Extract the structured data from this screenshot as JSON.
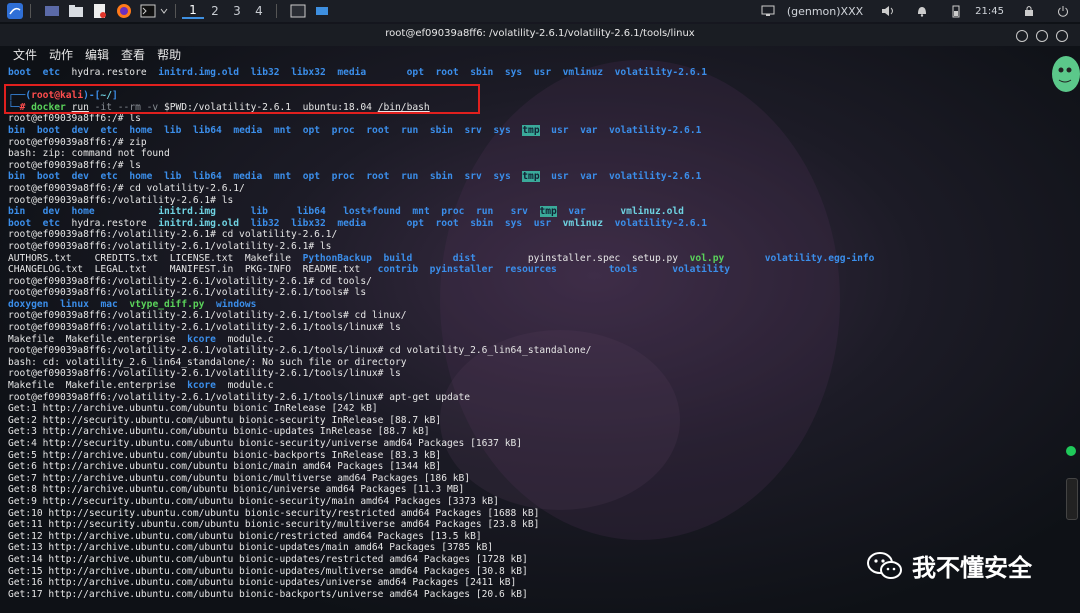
{
  "taskbar": {
    "workspaces": [
      "1",
      "2",
      "3",
      "4"
    ],
    "user": "(genmon)XXX",
    "time": "21:45",
    "icons": [
      "kali-menu-icon",
      "desktop-icon",
      "folder-icon",
      "text-editor-icon",
      "firefox-icon",
      "terminal-icon",
      "chevron-down-icon",
      "terminal-window-icon",
      "window-icon"
    ]
  },
  "window": {
    "title": "root@ef09039a8ff6: /volatility-2.6.1/volatility-2.6.1/tools/linux",
    "menu": [
      "文件",
      "动作",
      "编辑",
      "查看",
      "帮助"
    ]
  },
  "terminal": {
    "lines": [
      [
        [
          "boot",
          "blue"
        ],
        [
          "  "
        ],
        [
          "etc",
          "blue"
        ],
        [
          "  hydra.restore  "
        ],
        [
          "initrd.img.old",
          "blue"
        ],
        [
          "  "
        ],
        [
          "lib32",
          "blue"
        ],
        [
          "  "
        ],
        [
          "libx32",
          "blue"
        ],
        [
          "  "
        ],
        [
          "media",
          "blue"
        ],
        [
          "       "
        ],
        [
          "opt",
          "blue"
        ],
        [
          "  "
        ],
        [
          "root",
          "blue"
        ],
        [
          "  "
        ],
        [
          "sbin",
          "blue"
        ],
        [
          "  "
        ],
        [
          "sys",
          "blue"
        ],
        [
          "  "
        ],
        [
          "usr",
          "blue"
        ],
        [
          "  "
        ],
        [
          "vmlinuz",
          "blue"
        ],
        [
          "  "
        ],
        [
          "volatility-2.6.1",
          "blue"
        ]
      ],
      [
        [
          ""
        ]
      ],
      [
        [
          "┌──(",
          "blue"
        ],
        [
          "root@kali",
          "red"
        ],
        [
          ")-[",
          "blue"
        ],
        [
          "~/",
          "cyan"
        ],
        [
          "]",
          "blue"
        ]
      ],
      [
        [
          "└─",
          "blue"
        ],
        [
          "# ",
          "red"
        ],
        [
          "docker ",
          "green"
        ],
        [
          "run",
          "ul"
        ],
        [
          " -it --rm -v ",
          "dim"
        ],
        [
          "$PWD:/volatility-2.6.1  ubuntu:18.04 "
        ],
        [
          "/bin/bash",
          "ul"
        ]
      ],
      [
        [
          "root@ef09039a8ff6:/# ls"
        ]
      ],
      [
        [
          "bin",
          "blue"
        ],
        [
          "  "
        ],
        [
          "boot",
          "blue"
        ],
        [
          "  "
        ],
        [
          "dev",
          "blue"
        ],
        [
          "  "
        ],
        [
          "etc",
          "blue"
        ],
        [
          "  "
        ],
        [
          "home",
          "blue"
        ],
        [
          "  "
        ],
        [
          "lib",
          "blue"
        ],
        [
          "  "
        ],
        [
          "lib64",
          "blue"
        ],
        [
          "  "
        ],
        [
          "media",
          "blue"
        ],
        [
          "  "
        ],
        [
          "mnt",
          "blue"
        ],
        [
          "  "
        ],
        [
          "opt",
          "blue"
        ],
        [
          "  "
        ],
        [
          "proc",
          "blue"
        ],
        [
          "  "
        ],
        [
          "root",
          "blue"
        ],
        [
          "  "
        ],
        [
          "run",
          "blue"
        ],
        [
          "  "
        ],
        [
          "sbin",
          "blue"
        ],
        [
          "  "
        ],
        [
          "srv",
          "blue"
        ],
        [
          "  "
        ],
        [
          "sys",
          "blue"
        ],
        [
          "  "
        ],
        [
          "tmp",
          "hl"
        ],
        [
          "  "
        ],
        [
          "usr",
          "blue"
        ],
        [
          "  "
        ],
        [
          "var",
          "blue"
        ],
        [
          "  "
        ],
        [
          "volatility-2.6.1",
          "blue"
        ]
      ],
      [
        [
          "root@ef09039a8ff6:/# zip"
        ]
      ],
      [
        [
          "bash: zip: command not found"
        ]
      ],
      [
        [
          "root@ef09039a8ff6:/# ls"
        ]
      ],
      [
        [
          "bin",
          "blue"
        ],
        [
          "  "
        ],
        [
          "boot",
          "blue"
        ],
        [
          "  "
        ],
        [
          "dev",
          "blue"
        ],
        [
          "  "
        ],
        [
          "etc",
          "blue"
        ],
        [
          "  "
        ],
        [
          "home",
          "blue"
        ],
        [
          "  "
        ],
        [
          "lib",
          "blue"
        ],
        [
          "  "
        ],
        [
          "lib64",
          "blue"
        ],
        [
          "  "
        ],
        [
          "media",
          "blue"
        ],
        [
          "  "
        ],
        [
          "mnt",
          "blue"
        ],
        [
          "  "
        ],
        [
          "opt",
          "blue"
        ],
        [
          "  "
        ],
        [
          "proc",
          "blue"
        ],
        [
          "  "
        ],
        [
          "root",
          "blue"
        ],
        [
          "  "
        ],
        [
          "run",
          "blue"
        ],
        [
          "  "
        ],
        [
          "sbin",
          "blue"
        ],
        [
          "  "
        ],
        [
          "srv",
          "blue"
        ],
        [
          "  "
        ],
        [
          "sys",
          "blue"
        ],
        [
          "  "
        ],
        [
          "tmp",
          "hl"
        ],
        [
          "  "
        ],
        [
          "usr",
          "blue"
        ],
        [
          "  "
        ],
        [
          "var",
          "blue"
        ],
        [
          "  "
        ],
        [
          "volatility-2.6.1",
          "blue"
        ]
      ],
      [
        [
          "root@ef09039a8ff6:/# cd volatility-2.6.1/"
        ]
      ],
      [
        [
          "root@ef09039a8ff6:/volatility-2.6.1# ls"
        ]
      ],
      [
        [
          "bin",
          "blue"
        ],
        [
          "   "
        ],
        [
          "dev",
          "blue"
        ],
        [
          "  "
        ],
        [
          "home",
          "blue"
        ],
        [
          "           "
        ],
        [
          "initrd.img",
          "cyan"
        ],
        [
          "      "
        ],
        [
          "lib",
          "blue"
        ],
        [
          "     "
        ],
        [
          "lib64",
          "blue"
        ],
        [
          "   "
        ],
        [
          "lost+found",
          "blue"
        ],
        [
          "  "
        ],
        [
          "mnt",
          "blue"
        ],
        [
          "  "
        ],
        [
          "proc",
          "blue"
        ],
        [
          "  "
        ],
        [
          "run",
          "blue"
        ],
        [
          "   "
        ],
        [
          "srv",
          "blue"
        ],
        [
          "  "
        ],
        [
          "tmp",
          "hl"
        ],
        [
          "  "
        ],
        [
          "var",
          "blue"
        ],
        [
          "      "
        ],
        [
          "vmlinuz.old",
          "cyan"
        ]
      ],
      [
        [
          "boot",
          "blue"
        ],
        [
          "  "
        ],
        [
          "etc",
          "blue"
        ],
        [
          "  hydra.restore  "
        ],
        [
          "initrd.img.old",
          "cyan"
        ],
        [
          "  "
        ],
        [
          "lib32",
          "blue"
        ],
        [
          "  "
        ],
        [
          "libx32",
          "blue"
        ],
        [
          "  "
        ],
        [
          "media",
          "blue"
        ],
        [
          "       "
        ],
        [
          "opt",
          "blue"
        ],
        [
          "  "
        ],
        [
          "root",
          "blue"
        ],
        [
          "  "
        ],
        [
          "sbin",
          "blue"
        ],
        [
          "  "
        ],
        [
          "sys",
          "blue"
        ],
        [
          "  "
        ],
        [
          "usr",
          "blue"
        ],
        [
          "  "
        ],
        [
          "vmlinuz",
          "cyan"
        ],
        [
          "  "
        ],
        [
          "volatility-2.6.1",
          "blue"
        ]
      ],
      [
        [
          "root@ef09039a8ff6:/volatility-2.6.1# cd volatility-2.6.1/"
        ]
      ],
      [
        [
          "root@ef09039a8ff6:/volatility-2.6.1/volatility-2.6.1# ls"
        ]
      ],
      [
        [
          "AUTHORS.txt    CREDITS.txt  LICENSE.txt  Makefile  "
        ],
        [
          "PythonBackup",
          "blue"
        ],
        [
          "  "
        ],
        [
          "build",
          "blue"
        ],
        [
          "       "
        ],
        [
          "dist",
          "blue"
        ],
        [
          "         pyinstaller.spec  setup.py  "
        ],
        [
          "vol.py",
          "green"
        ],
        [
          "       "
        ],
        [
          "volatility.egg-info",
          "blue"
        ]
      ],
      [
        [
          "CHANGELOG.txt  LEGAL.txt    MANIFEST.in  PKG-INFO  README.txt   "
        ],
        [
          "contrib",
          "blue"
        ],
        [
          "  "
        ],
        [
          "pyinstaller",
          "blue"
        ],
        [
          "  "
        ],
        [
          "resources",
          "blue"
        ],
        [
          "         "
        ],
        [
          "tools",
          "blue"
        ],
        [
          "      "
        ],
        [
          "volatility",
          "blue"
        ]
      ],
      [
        [
          "root@ef09039a8ff6:/volatility-2.6.1/volatility-2.6.1# cd tools/"
        ]
      ],
      [
        [
          "root@ef09039a8ff6:/volatility-2.6.1/volatility-2.6.1/tools# ls"
        ]
      ],
      [
        [
          "doxygen",
          "blue"
        ],
        [
          "  "
        ],
        [
          "linux",
          "blue"
        ],
        [
          "  "
        ],
        [
          "mac",
          "blue"
        ],
        [
          "  "
        ],
        [
          "vtype_diff.py",
          "green"
        ],
        [
          "  "
        ],
        [
          "windows",
          "blue"
        ]
      ],
      [
        [
          "root@ef09039a8ff6:/volatility-2.6.1/volatility-2.6.1/tools# cd linux/"
        ]
      ],
      [
        [
          "root@ef09039a8ff6:/volatility-2.6.1/volatility-2.6.1/tools/linux# ls"
        ]
      ],
      [
        [
          "Makefile  Makefile.enterprise  "
        ],
        [
          "kcore",
          "blue"
        ],
        [
          "  module.c"
        ]
      ],
      [
        [
          "root@ef09039a8ff6:/volatility-2.6.1/volatility-2.6.1/tools/linux# cd volatility_2.6_lin64_standalone/"
        ]
      ],
      [
        [
          "bash: cd: volatility_2.6_lin64_standalone/: No such file or directory"
        ]
      ],
      [
        [
          "root@ef09039a8ff6:/volatility-2.6.1/volatility-2.6.1/tools/linux# ls"
        ]
      ],
      [
        [
          "Makefile  Makefile.enterprise  "
        ],
        [
          "kcore",
          "blue"
        ],
        [
          "  module.c"
        ]
      ],
      [
        [
          "root@ef09039a8ff6:/volatility-2.6.1/volatility-2.6.1/tools/linux# apt-get update"
        ]
      ],
      [
        [
          "Get:1 http://archive.ubuntu.com/ubuntu bionic InRelease [242 kB]"
        ]
      ],
      [
        [
          "Get:2 http://security.ubuntu.com/ubuntu bionic-security InRelease [88.7 kB]"
        ]
      ],
      [
        [
          "Get:3 http://archive.ubuntu.com/ubuntu bionic-updates InRelease [88.7 kB]"
        ]
      ],
      [
        [
          "Get:4 http://security.ubuntu.com/ubuntu bionic-security/universe amd64 Packages [1637 kB]"
        ]
      ],
      [
        [
          "Get:5 http://archive.ubuntu.com/ubuntu bionic-backports InRelease [83.3 kB]"
        ]
      ],
      [
        [
          "Get:6 http://archive.ubuntu.com/ubuntu bionic/main amd64 Packages [1344 kB]"
        ]
      ],
      [
        [
          "Get:7 http://archive.ubuntu.com/ubuntu bionic/multiverse amd64 Packages [186 kB]"
        ]
      ],
      [
        [
          "Get:8 http://archive.ubuntu.com/ubuntu bionic/universe amd64 Packages [11.3 MB]"
        ]
      ],
      [
        [
          "Get:9 http://security.ubuntu.com/ubuntu bionic-security/main amd64 Packages [3373 kB]"
        ]
      ],
      [
        [
          "Get:10 http://security.ubuntu.com/ubuntu bionic-security/restricted amd64 Packages [1688 kB]"
        ]
      ],
      [
        [
          "Get:11 http://security.ubuntu.com/ubuntu bionic-security/multiverse amd64 Packages [23.8 kB]"
        ]
      ],
      [
        [
          "Get:12 http://archive.ubuntu.com/ubuntu bionic/restricted amd64 Packages [13.5 kB]"
        ]
      ],
      [
        [
          "Get:13 http://archive.ubuntu.com/ubuntu bionic-updates/main amd64 Packages [3785 kB]"
        ]
      ],
      [
        [
          "Get:14 http://archive.ubuntu.com/ubuntu bionic-updates/restricted amd64 Packages [1728 kB]"
        ]
      ],
      [
        [
          "Get:15 http://archive.ubuntu.com/ubuntu bionic-updates/multiverse amd64 Packages [30.8 kB]"
        ]
      ],
      [
        [
          "Get:16 http://archive.ubuntu.com/ubuntu bionic-updates/universe amd64 Packages [2411 kB]"
        ]
      ],
      [
        [
          "Get:17 http://archive.ubuntu.com/ubuntu bionic-backports/universe amd64 Packages [20.6 kB]"
        ]
      ]
    ]
  },
  "watermark": {
    "text": "我不懂安全",
    "icon": "wechat-icon"
  },
  "colors": {
    "accent_blue": "#3b8eea",
    "highlight": "#3aaa9a",
    "annotation_red": "#e0201e"
  }
}
